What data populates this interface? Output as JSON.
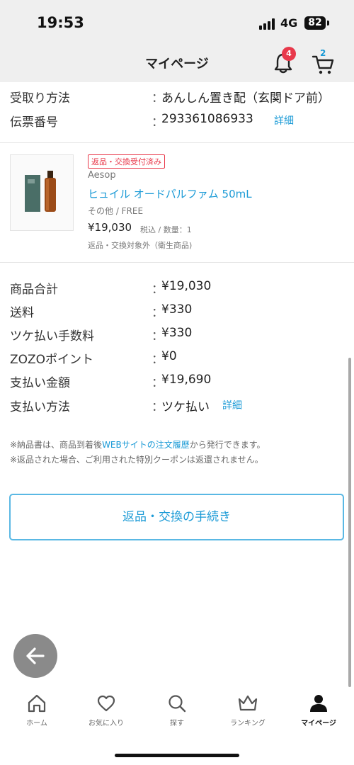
{
  "status_bar": {
    "time": "19:53",
    "network": "4G",
    "battery": "82"
  },
  "header": {
    "title": "マイページ",
    "notification_count": "4",
    "cart_count": "2"
  },
  "shipping": {
    "method_label": "受取り方法",
    "method_value": "あんしん置き配（玄関ドア前）",
    "tracking_label": "伝票番号",
    "tracking_value": "293361086933",
    "tracking_link": "詳細",
    "separator": "："
  },
  "product": {
    "tag": "返品・交換受付済み",
    "brand": "Aesop",
    "name": "ヒュイル オードパルファム 50mL",
    "variant": "その他 / FREE",
    "price": "¥19,030",
    "price_meta": "税込 / 数量：1",
    "note": "返品・交換対象外（衛生商品)"
  },
  "summary": [
    {
      "label": "商品合計",
      "value": "¥19,030"
    },
    {
      "label": "送料",
      "value": "¥330"
    },
    {
      "label": "ツケ払い手数料",
      "value": "¥330"
    },
    {
      "label": "ZOZOポイント",
      "value": "¥0"
    },
    {
      "label": "支払い金額",
      "value": "¥19,690"
    },
    {
      "label": "支払い方法",
      "value": "ツケ払い",
      "link": "詳細"
    }
  ],
  "notes": {
    "line1_a": "※納品書は、商品到着後",
    "line1_link": "WEBサイトの注文履歴",
    "line1_b": "から発行できます。",
    "line2": "※返品された場合、ご利用された特別クーポンは返還されません。"
  },
  "return_button": "返品・交換の手続き",
  "tabbar": [
    {
      "label": "ホーム",
      "icon": "home-icon"
    },
    {
      "label": "お気に入り",
      "icon": "heart-icon"
    },
    {
      "label": "探す",
      "icon": "search-icon"
    },
    {
      "label": "ランキング",
      "icon": "crown-icon"
    },
    {
      "label": "マイページ",
      "icon": "person-icon",
      "active": true
    }
  ],
  "colors": {
    "accent": "#1a9ad6",
    "badge": "#e8394b",
    "header_bg": "#efefef"
  }
}
